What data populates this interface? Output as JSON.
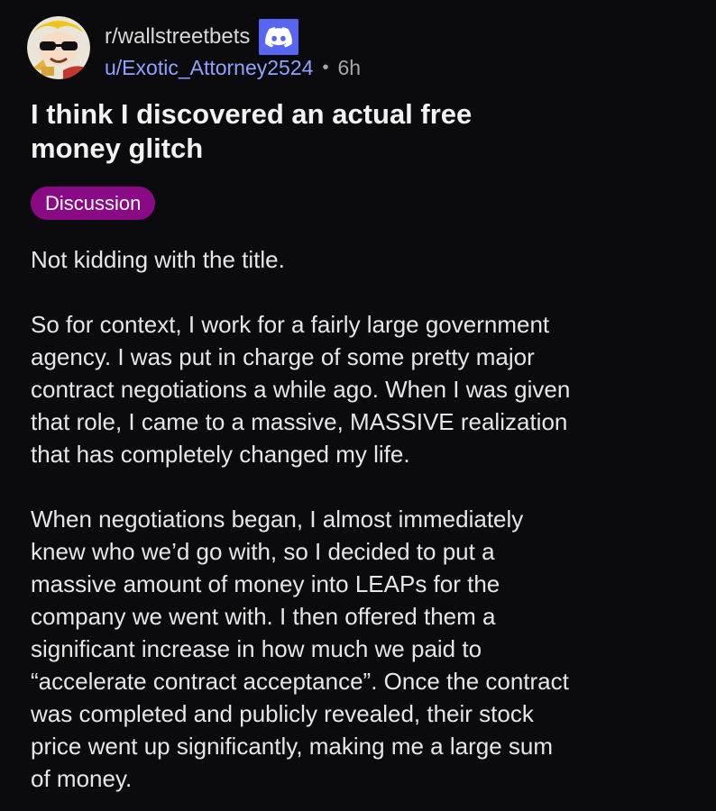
{
  "header": {
    "subreddit": "r/wallstreetbets",
    "username": "u/Exotic_Attorney2524",
    "separator": "•",
    "age": "6h",
    "icons": {
      "avatar": "snoo-sunglasses-avatar",
      "discord": "discord-icon"
    }
  },
  "post": {
    "title": "I think I discovered an actual free\nmoney glitch",
    "flair": "Discussion",
    "paragraphs": [
      "Not kidding with the title.",
      "So for context, I work for a fairly large government\nagency. I was put in charge of some pretty major\ncontract negotiations a while ago. When I was given\nthat role, I came to a massive, MASSIVE realization\nthat has completely changed my life.",
      "When negotiations began, I almost immediately\nknew who we’d go with, so I decided to put a\nmassive amount of money into LEAPs for the\ncompany we went with. I then offered them a\nsignificant increase in how much we paid to\n“accelerate contract acceptance”. Once the contract\nwas completed and publicly revealed, their stock\nprice went up significantly, making me a large sum\nof money."
    ]
  },
  "colors": {
    "background": "#0b0b0d",
    "username": "#8fa2ff",
    "flair_bg": "#8a0a86",
    "discord": "#5865f2"
  }
}
